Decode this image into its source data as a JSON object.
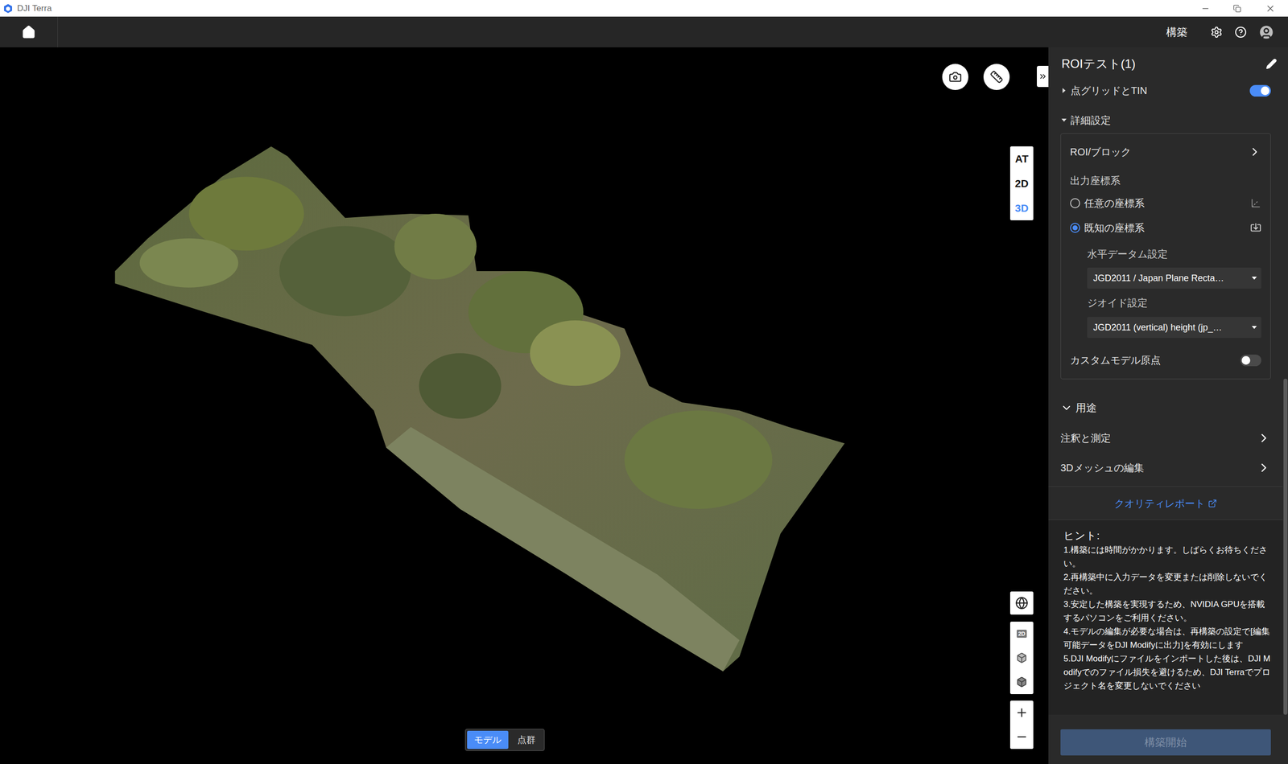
{
  "window": {
    "title": "DJI Terra"
  },
  "nav": {
    "action": "構築"
  },
  "viewport": {
    "view_modes": [
      {
        "label": "AT",
        "selected": false
      },
      {
        "label": "2D",
        "selected": false
      },
      {
        "label": "3D",
        "selected": true
      }
    ],
    "display_modes": [
      {
        "label": "モデル",
        "selected": true
      },
      {
        "label": "点群",
        "selected": false
      }
    ],
    "map_mode_label": "2D"
  },
  "panel": {
    "title": "ROIテスト(1)",
    "point_grid": {
      "label": "点グリッドとTIN",
      "expanded": false,
      "on": true
    },
    "advanced": {
      "label": "詳細設定",
      "expanded": true,
      "roi": "ROI/ブロック",
      "coord_label": "出力座標系",
      "coord_options": [
        {
          "label": "任意の座標系",
          "selected": false
        },
        {
          "label": "既知の座標系",
          "selected": true
        }
      ],
      "horizontal": {
        "label": "水平データム設定",
        "value": "JGD2011 / Japan Plane Recta…"
      },
      "geoid": {
        "label": "ジオイド設定",
        "value": "JGD2011 (vertical) height (jp_…"
      },
      "custom_origin": {
        "label": "カスタムモデル原点",
        "on": false
      }
    },
    "usage": {
      "label": "用途",
      "expanded": true,
      "items": [
        "注釈と測定",
        "3Dメッシュの編集"
      ]
    },
    "quality_report": "クオリティレポート",
    "hints": {
      "title": "ヒント:",
      "lines": [
        "1.構築には時間がかかります。しばらくお待ちください。",
        "2.再構築中に入力データを変更または削除しないでください。",
        "3.安定した構築を実現するため、NVIDIA GPUを搭載するパソコンをご利用ください。",
        "4.モデルの編集が必要な場合は、再構築の設定で[編集可能データをDJI Modifyに出力]を有効にします",
        "5.DJI Modifyにファイルをインポートした後は、DJI Modifyでのファイル損失を避けるため、DJI Terraでプロジェクト名を変更しないでください"
      ]
    },
    "build_button": {
      "label": "構築開始",
      "disabled": true
    },
    "scrollbar": {
      "level": 0.53
    }
  }
}
